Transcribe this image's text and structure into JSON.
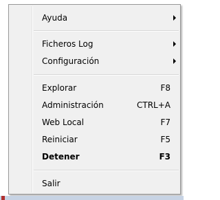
{
  "menu": {
    "items": [
      {
        "label": "Ayuda",
        "shortcut": "",
        "submenu": true
      },
      {
        "label": "Ficheros Log",
        "shortcut": "",
        "submenu": true
      },
      {
        "label": "Configuración",
        "shortcut": "",
        "submenu": true
      },
      {
        "label": "Explorar",
        "shortcut": "F8",
        "submenu": false
      },
      {
        "label": "Administración",
        "shortcut": "CTRL+A",
        "submenu": false
      },
      {
        "label": "Web Local",
        "shortcut": "F7",
        "submenu": false
      },
      {
        "label": "Reiniciar",
        "shortcut": "F5",
        "submenu": false
      },
      {
        "label": "Detener",
        "shortcut": "F3",
        "submenu": false,
        "default": true
      },
      {
        "label": "Salir",
        "shortcut": "",
        "submenu": false
      }
    ]
  },
  "colors": {
    "menu_background": "#f0f0f0",
    "menu_border": "#979797",
    "text": "#000000"
  }
}
